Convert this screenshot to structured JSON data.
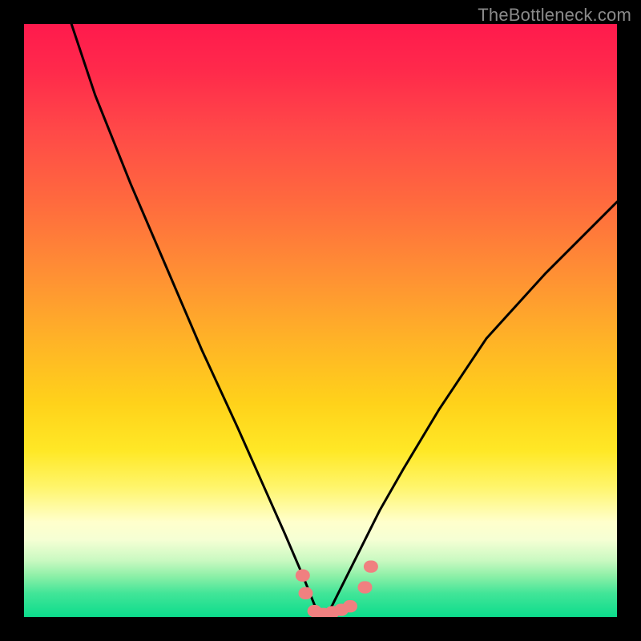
{
  "watermark": "TheBottleneck.com",
  "chart_data": {
    "type": "line",
    "title": "",
    "xlabel": "",
    "ylabel": "",
    "xlim": [
      0,
      100
    ],
    "ylim": [
      0,
      100
    ],
    "grid": false,
    "legend": null,
    "background_gradient": {
      "stops": [
        {
          "pos": 0.0,
          "color": "#ff1a4d"
        },
        {
          "pos": 0.3,
          "color": "#ff6a3e"
        },
        {
          "pos": 0.6,
          "color": "#ffd21a"
        },
        {
          "pos": 0.84,
          "color": "#ffffcc"
        },
        {
          "pos": 1.0,
          "color": "#0cdc8c"
        }
      ]
    },
    "series": [
      {
        "name": "bottleneck-curve",
        "color": "#000000",
        "x": [
          8,
          12,
          18,
          24,
          30,
          36,
          40,
          44,
          47,
          49,
          50,
          51,
          52,
          54,
          57,
          60,
          64,
          70,
          78,
          88,
          100
        ],
        "y": [
          100,
          88,
          73,
          59,
          45,
          32,
          23,
          14,
          7,
          2,
          0.5,
          0.5,
          2,
          6,
          12,
          18,
          25,
          35,
          47,
          58,
          70
        ]
      }
    ],
    "markers": [
      {
        "name": "left-cluster-top",
        "x": 47.0,
        "y": 7.0
      },
      {
        "name": "left-cluster-mid",
        "x": 47.5,
        "y": 4.0
      },
      {
        "name": "bottom-group-1",
        "x": 49.0,
        "y": 1.0
      },
      {
        "name": "bottom-group-2",
        "x": 50.5,
        "y": 0.5
      },
      {
        "name": "bottom-group-3",
        "x": 52.0,
        "y": 0.8
      },
      {
        "name": "bottom-group-4",
        "x": 53.5,
        "y": 1.2
      },
      {
        "name": "bottom-group-5",
        "x": 55.0,
        "y": 1.8
      },
      {
        "name": "right-cluster-low",
        "x": 57.5,
        "y": 5.0
      },
      {
        "name": "right-cluster-high",
        "x": 58.5,
        "y": 8.5
      }
    ],
    "marker_style": {
      "color": "#f08080",
      "radius_px": 9
    }
  }
}
